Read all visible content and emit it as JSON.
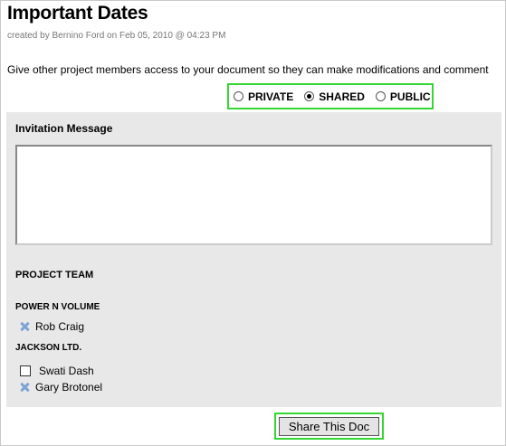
{
  "doc": {
    "title": "Important Dates",
    "created": "created by Bernino Ford on Feb 05, 2010 @ 04:23 PM",
    "intro": "Give other project members access to your document so they can make modifications and comment"
  },
  "privacy": {
    "options": [
      "PRIVATE",
      "SHARED",
      "PUBLIC"
    ],
    "selected": "SHARED"
  },
  "panel": {
    "invitation_label": "Invitation Message",
    "invitation_value": "",
    "team_heading": "PROJECT TEAM",
    "groups": [
      {
        "name": "POWER N VOLUME",
        "members": [
          {
            "name": "Rob Craig",
            "control": "remove-icon"
          }
        ]
      },
      {
        "name": "JACKSON LTD.",
        "members": [
          {
            "name": "Swati Dash",
            "control": "checkbox",
            "checked": false
          },
          {
            "name": "Gary Brotonel",
            "control": "remove-icon"
          }
        ]
      }
    ]
  },
  "actions": {
    "share_label": "Share This Doc"
  },
  "colors": {
    "highlight": "#33d633",
    "panel_bg": "#e8e8e8",
    "remove_icon": "#7da3d6"
  }
}
